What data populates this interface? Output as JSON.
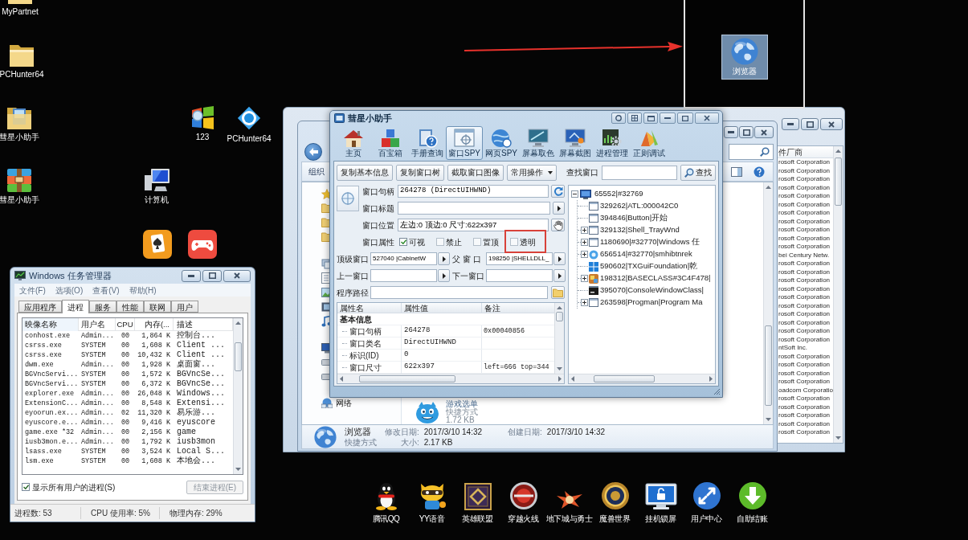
{
  "desktop_icons": [
    {
      "label": "MyPartnet",
      "kind": "folder"
    },
    {
      "label": "PCHunter64",
      "kind": "folder"
    },
    {
      "label": "彗星小助手",
      "kind": "photo_folder"
    },
    {
      "label": "彗星小助手",
      "kind": "archive"
    },
    {
      "label": "123",
      "kind": "flag"
    },
    {
      "label": "PCHunter64",
      "kind": "diamond"
    },
    {
      "label": "计算机",
      "kind": "computer"
    },
    {
      "kind": "card"
    },
    {
      "kind": "gamepad"
    }
  ],
  "corner_frame": {
    "icon": {
      "label": "浏览器",
      "selected": true
    }
  },
  "back_window": {
    "column_header": "件厂商",
    "rows": [
      "rosoft Corporation",
      "rosoft Corporation",
      "rosoft Corporation",
      "rosoft Corporation",
      "rosoft Corporation",
      "rosoft Corporation",
      "rosoft Corporation",
      "rosoft Corporation",
      "rosoft Corporation",
      "rosoft Corporation",
      "rosoft Corporation",
      "bei Century Netw.",
      "rosoft Corporation",
      "rosoft Corporation",
      "rosoft Corporation",
      "rosoft Corporation",
      "rosoft Corporation",
      "rosoft Corporation",
      "rosoft Corporation",
      "rosoft Corporation",
      "rosoft Corporation",
      "rosoft Corporation",
      "ntSoft Inc.",
      "rosoft Corporation",
      "rosoft Corporation",
      "rosoft Corporation",
      "rosoft Corporation",
      "oadcom Corporatio",
      "rosoft Corporation",
      "rosoft Corporation",
      "rosoft Corporation",
      "rosoft Corporation",
      "rosoft Corporation"
    ]
  },
  "explorer": {
    "organize": "组织",
    "network": "网络",
    "file": {
      "name": "游戏选单",
      "type": "快捷方式",
      "size": "1.72 KB"
    },
    "details": {
      "name": "浏览器",
      "type": "快捷方式",
      "fields": [
        {
          "label": "修改日期:",
          "value": "2017/3/10 14:32"
        },
        {
          "label": "创建日期:",
          "value": "2017/3/10 14:32"
        },
        {
          "label": "大小:",
          "value": "2.17 KB"
        }
      ]
    }
  },
  "helper": {
    "title": "彗星小助手",
    "tools": [
      {
        "label": "主页",
        "kind": "home",
        "selected": false
      },
      {
        "label": "百宝箱",
        "kind": "blocks",
        "selected": false
      },
      {
        "label": "手册查询",
        "kind": "manual",
        "selected": false
      },
      {
        "label": "窗口SPY",
        "kind": "window_spy",
        "selected": true
      },
      {
        "label": "网页SPY",
        "kind": "web_spy",
        "selected": false
      },
      {
        "label": "屏幕取色",
        "kind": "color_pick",
        "selected": false
      },
      {
        "label": "屏幕截图",
        "kind": "screenshot",
        "selected": false
      },
      {
        "label": "进程管理",
        "kind": "process",
        "selected": false
      },
      {
        "label": "正则调试",
        "kind": "regex",
        "selected": false
      }
    ],
    "actions": [
      "复制基本信息",
      "复制窗口树",
      "截取窗口图像"
    ],
    "menu_button": "常用操作",
    "find": {
      "label": "查找窗口",
      "button": "查找"
    },
    "handle": {
      "label": "窗口句柄",
      "value": "264278 (DirectUIHWND)"
    },
    "window_title": {
      "label": "窗口标题"
    },
    "position": {
      "label": "窗口位置",
      "value": "左边:0 顶边:0 尺寸:622x397"
    },
    "attributes": {
      "label": "窗口属性",
      "options": [
        {
          "label": "可视",
          "checked": true,
          "highlighted": false
        },
        {
          "label": "禁止",
          "checked": false,
          "highlighted": false
        },
        {
          "label": "置顶",
          "checked": false,
          "highlighted": false
        },
        {
          "label": "透明",
          "checked": false,
          "highlighted": true
        }
      ]
    },
    "links": [
      {
        "label": "顶级窗口",
        "value": "527040 |CabinetW"
      },
      {
        "label": "父 窗 口",
        "value": "198250 |SHELLDLL_"
      },
      {
        "label": "上一窗口"
      },
      {
        "label": "下一窗口"
      }
    ],
    "path": {
      "label": "程序路径"
    },
    "properties": {
      "columns": [
        "属性名",
        "属性值",
        "备注"
      ],
      "group": "基本信息",
      "rows": [
        {
          "name": "窗口句柄",
          "value": "264278",
          "note": "0x00040856"
        },
        {
          "name": "窗口类名",
          "value": "DirectUIHWND"
        },
        {
          "name": "标识(ID)",
          "value": "0"
        },
        {
          "name": "窗口尺寸",
          "value": "622x397",
          "note": "left=666 top=344"
        }
      ]
    },
    "tree": {
      "label": "65552|#32769",
      "kind": "monitor",
      "expanded": true,
      "children": [
        {
          "label": "329262|ATL:000042C0",
          "kind": "window",
          "expandable": false
        },
        {
          "label": "394846|Button|开始",
          "kind": "window",
          "expandable": false
        },
        {
          "label": "329132|Shell_TrayWnd",
          "kind": "window",
          "expandable": true
        },
        {
          "label": "1180690|#32770|Windows 任",
          "kind": "window",
          "expandable": true
        },
        {
          "label": "656514|#32770|smhibtnrek",
          "kind": "orb",
          "expandable": true
        },
        {
          "label": "590602|TXGuiFoundation|乾",
          "kind": "tiles",
          "expandable": false
        },
        {
          "label": "198312|BASECLASS#3C4F478|",
          "kind": "cube",
          "expandable": true
        },
        {
          "label": "395070|ConsoleWindowClass|",
          "kind": "console",
          "expandable": false
        },
        {
          "label": "263598|Progman|Program Ma",
          "kind": "window",
          "expandable": true
        }
      ]
    }
  },
  "task_manager": {
    "title": "Windows 任务管理器",
    "menu": [
      "文件(F)",
      "选项(O)",
      "查看(V)",
      "帮助(H)"
    ],
    "tabs": [
      {
        "label": "应用程序",
        "selected": false
      },
      {
        "label": "进程",
        "selected": true
      },
      {
        "label": "服务",
        "selected": false
      },
      {
        "label": "性能",
        "selected": false
      },
      {
        "label": "联网",
        "selected": false
      },
      {
        "label": "用户",
        "selected": false
      }
    ],
    "columns": [
      "映像名称",
      "用户名",
      "CPU",
      "内存(...",
      "描述"
    ],
    "rows": [
      [
        "conhost.exe",
        "Admin...",
        "00",
        "1,864 K",
        "控制台..."
      ],
      [
        "csrss.exe",
        "SYSTEM",
        "00",
        "1,608 K",
        "Client ..."
      ],
      [
        "csrss.exe",
        "SYSTEM",
        "00",
        "10,432 K",
        "Client ..."
      ],
      [
        "dwm.exe",
        "Admin...",
        "00",
        "1,928 K",
        "桌面窗..."
      ],
      [
        "BGVncServi...",
        "SYSTEM",
        "00",
        "1,572 K",
        "BGVncSe..."
      ],
      [
        "BGVncServi...",
        "SYSTEM",
        "00",
        "6,372 K",
        "BGVncSe..."
      ],
      [
        "explorer.exe",
        "Admin...",
        "00",
        "26,048 K",
        "Windows..."
      ],
      [
        "ExtensionC...",
        "Admin...",
        "00",
        "8,548 K",
        "Extensi..."
      ],
      [
        "eyoorun.ex...",
        "Admin...",
        "02",
        "11,320 K",
        "易乐游..."
      ],
      [
        "eyuscore.e...",
        "Admin...",
        "00",
        "9,416 K",
        "eyuscore"
      ],
      [
        "game.exe *32",
        "Admin...",
        "00",
        "2,156 K",
        "game"
      ],
      [
        "iusb3mon.e...",
        "Admin...",
        "00",
        "1,792 K",
        "iusb3mon"
      ],
      [
        "lsass.exe",
        "SYSTEM",
        "00",
        "3,524 K",
        "Local S..."
      ],
      [
        "lsm.exe",
        "SYSTEM",
        "00",
        "1,608 K",
        "本地会..."
      ]
    ],
    "show_all": {
      "label": "显示所有用户的进程(S)",
      "checked": true
    },
    "end_button": {
      "label": "结束进程(E)",
      "disabled": true
    },
    "status": [
      "进程数: 53",
      "CPU 使用率: 5%",
      "物理内存: 29%"
    ]
  },
  "dock": [
    {
      "label": "腾讯QQ",
      "kind": "penguin"
    },
    {
      "label": "YY语音",
      "kind": "raccoon"
    },
    {
      "label": "英雄联盟",
      "kind": "emblem"
    },
    {
      "label": "穿越火线",
      "kind": "disc"
    },
    {
      "label": "地下城与勇士",
      "kind": "creature"
    },
    {
      "label": "魔兽世界",
      "kind": "ring"
    },
    {
      "label": "挂机锁屏",
      "kind": "lock_screen"
    },
    {
      "label": "用户中心",
      "kind": "arrows"
    },
    {
      "label": "自助结账",
      "kind": "download"
    }
  ]
}
